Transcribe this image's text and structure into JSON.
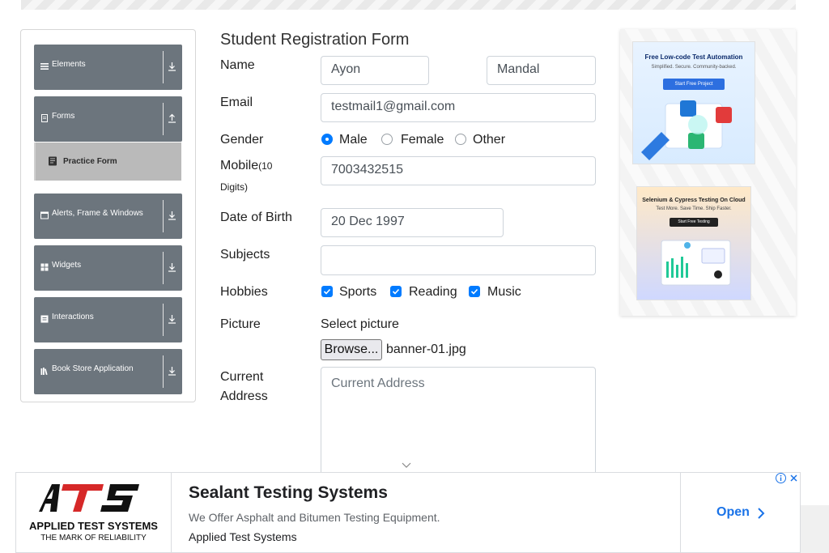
{
  "sidebar": {
    "groups": [
      {
        "label": "Elements",
        "icon": "list-icon",
        "arrow": "download-arrow-icon"
      },
      {
        "label": "Forms",
        "icon": "file-icon",
        "arrow": "upload-arrow-icon"
      },
      {
        "label": "Alerts, Frame & Windows",
        "icon": "window-icon",
        "arrow": "download-arrow-icon"
      },
      {
        "label": "Widgets",
        "icon": "grid-icon",
        "arrow": "download-arrow-icon"
      },
      {
        "label": "Interactions",
        "icon": "square-icon",
        "arrow": "download-arrow-icon"
      },
      {
        "label": "Book Store Application",
        "icon": "books-icon",
        "arrow": "download-arrow-icon"
      }
    ],
    "active_item": {
      "label": "Practice Form",
      "icon": "form-icon"
    }
  },
  "form": {
    "title": "Student Registration Form",
    "labels": {
      "name": "Name",
      "email": "Email",
      "gender": "Gender",
      "mobile": "Mobile",
      "mobile_hint": "(10 Digits)",
      "dob": "Date of Birth",
      "subjects": "Subjects",
      "hobbies": "Hobbies",
      "picture": "Picture",
      "address_line1": "Current",
      "address_line2": "Address"
    },
    "first_name": "Ayon",
    "last_name": "Mandal",
    "email": "testmail1@gmail.com",
    "gender_options": [
      "Male",
      "Female",
      "Other"
    ],
    "gender_selected": "Male",
    "mobile": "7003432515",
    "dob": "20 Dec 1997",
    "subjects": "",
    "hobbies": [
      {
        "label": "Sports",
        "checked": true
      },
      {
        "label": "Reading",
        "checked": true
      },
      {
        "label": "Music",
        "checked": true
      }
    ],
    "picture_prompt": "Select picture",
    "browse_label": "Browse...",
    "file_name": "banner-01.jpg",
    "address_placeholder": "Current Address"
  },
  "right_ads": {
    "ad1": {
      "title": "Free Low-code Test Automation",
      "subtitle": "Simplified. Secure. Community-backed.",
      "button": "Start Free Project"
    },
    "ad2": {
      "title": "Selenium & Cypress Testing On Cloud",
      "subtitle": "Test More. Save Time. Ship Faster.",
      "button": "Start Free Testing"
    }
  },
  "bottom_ad": {
    "logo_name": "APPLIED TEST SYSTEMS",
    "logo_tagline": "THE MARK OF RELIABILITY",
    "headline": "Sealant Testing Systems",
    "description": "We Offer Asphalt and Bitumen Testing Equipment.",
    "advertiser": "Applied Test Systems",
    "cta": "Open"
  },
  "colors": {
    "sidebar_group": "#6c757d",
    "accent": "#007bff",
    "cta": "#1a73e8"
  }
}
